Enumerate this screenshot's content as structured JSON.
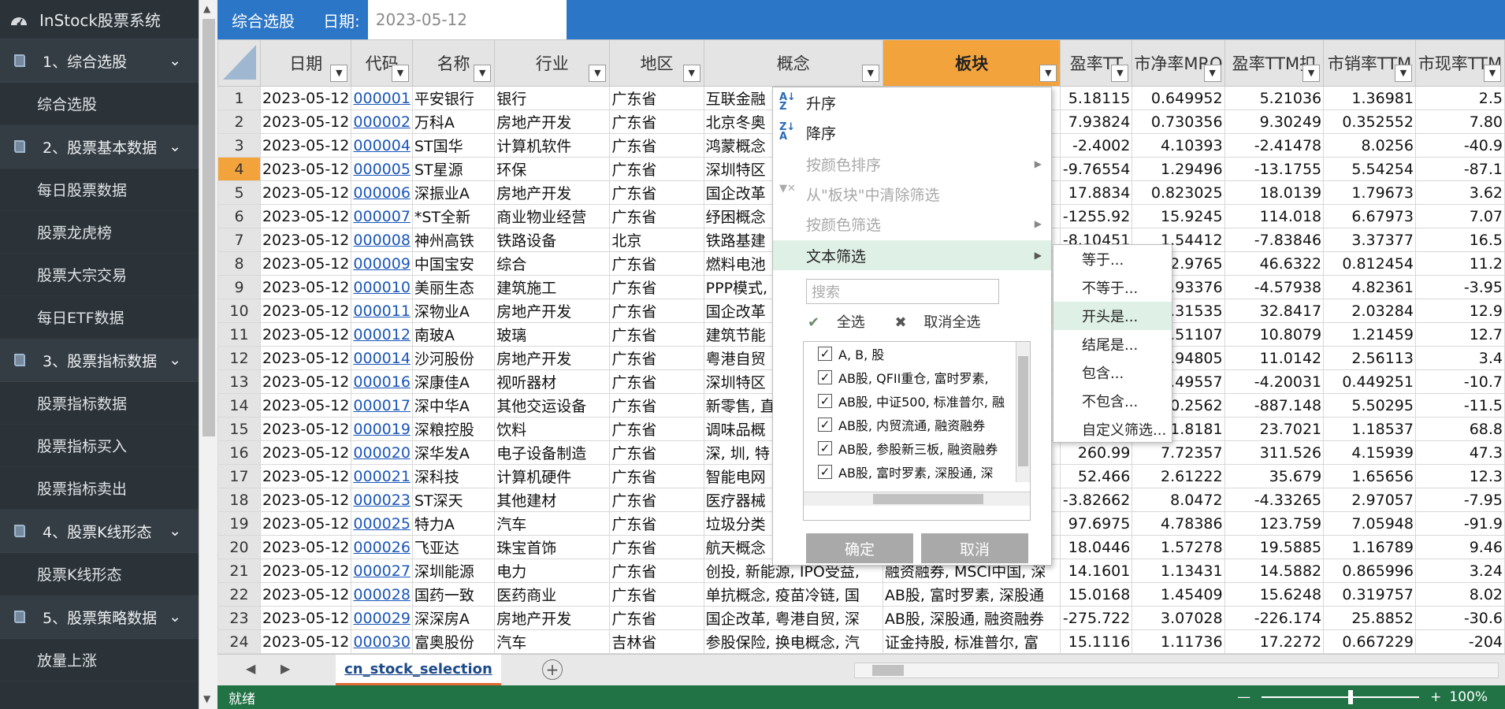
{
  "app": {
    "title": "InStock股票系统"
  },
  "sidebar": {
    "sections": [
      {
        "label": "1、综合选股",
        "items": [
          "综合选股"
        ]
      },
      {
        "label": "2、股票基本数据",
        "items": [
          "每日股票数据",
          "股票龙虎榜",
          "股票大宗交易",
          "每日ETF数据"
        ]
      },
      {
        "label": "3、股票指标数据",
        "items": [
          "股票指标数据",
          "股票指标买入",
          "股票指标卖出"
        ]
      },
      {
        "label": "4、股票K线形态",
        "items": [
          "股票K线形态"
        ]
      },
      {
        "label": "5、股票策略数据",
        "items": [
          "放量上涨"
        ]
      }
    ]
  },
  "topbar": {
    "title": "综合选股",
    "date_label": "日期:",
    "date_value": "2023-05-12"
  },
  "table": {
    "headers": [
      "日期",
      "代码",
      "名称",
      "行业",
      "地区",
      "概念",
      "板块",
      "盈率TT",
      "市净率MRQ",
      "盈率TTM扣",
      "市销率TTM",
      "市现率TTM"
    ],
    "selected_row": "4",
    "rows": [
      {
        "n": "1",
        "date": "2023-05-12",
        "code": "000001",
        "name": "平安银行",
        "industry": "银行",
        "region": "广东省",
        "concept": "互联金融",
        "board": "",
        "c1": "5.18115",
        "c2": "0.649952",
        "c3": "5.21036",
        "c4": "1.36981",
        "c5": "2.5"
      },
      {
        "n": "2",
        "date": "2023-05-12",
        "code": "000002",
        "name": "万科A",
        "industry": "房地产开发",
        "region": "广东省",
        "concept": "北京冬奥",
        "board": "",
        "c1": "7.93824",
        "c2": "0.730356",
        "c3": "9.30249",
        "c4": "0.352552",
        "c5": "7.80"
      },
      {
        "n": "3",
        "date": "2023-05-12",
        "code": "000004",
        "name": "ST国华",
        "industry": "计算机软件",
        "region": "广东省",
        "concept": "鸿蒙概念",
        "board": "",
        "c1": "-2.4002",
        "c2": "4.10393",
        "c3": "-2.41478",
        "c4": "8.0256",
        "c5": "-40.9"
      },
      {
        "n": "4",
        "date": "2023-05-12",
        "code": "000005",
        "name": "ST星源",
        "industry": "环保",
        "region": "广东省",
        "concept": "深圳特区",
        "board": "",
        "c1": "-9.76554",
        "c2": "1.29496",
        "c3": "-13.1755",
        "c4": "5.54254",
        "c5": "-87.1"
      },
      {
        "n": "5",
        "date": "2023-05-12",
        "code": "000006",
        "name": "深振业A",
        "industry": "房地产开发",
        "region": "广东省",
        "concept": "国企改革",
        "board": "",
        "c1": "17.8834",
        "c2": "0.823025",
        "c3": "18.0139",
        "c4": "1.79673",
        "c5": "3.62"
      },
      {
        "n": "6",
        "date": "2023-05-12",
        "code": "000007",
        "name": "*ST全新",
        "industry": "商业物业经营",
        "region": "广东省",
        "concept": "纾困概念",
        "board": "",
        "c1": "-1255.92",
        "c2": "15.9245",
        "c3": "114.018",
        "c4": "6.67973",
        "c5": "7.07"
      },
      {
        "n": "7",
        "date": "2023-05-12",
        "code": "000008",
        "name": "神州高铁",
        "industry": "铁路设备",
        "region": "北京",
        "concept": "铁路基建",
        "board": "",
        "c1": "-8.10451",
        "c2": "1.54412",
        "c3": "-7.83846",
        "c4": "3.37377",
        "c5": "16.5"
      },
      {
        "n": "8",
        "date": "2023-05-12",
        "code": "000009",
        "name": "中国宝安",
        "industry": "综合",
        "region": "广东省",
        "concept": "燃料电池",
        "board": "",
        "c1": "",
        "c2": "2.9765",
        "c3": "46.6322",
        "c4": "0.812454",
        "c5": "11.2"
      },
      {
        "n": "9",
        "date": "2023-05-12",
        "code": "000010",
        "name": "美丽生态",
        "industry": "建筑施工",
        "region": "广东省",
        "concept": "PPP模式,",
        "board": "",
        "c1": "",
        "c2": "3.93376",
        "c3": "-4.57938",
        "c4": "4.82361",
        "c5": "-3.95"
      },
      {
        "n": "10",
        "date": "2023-05-12",
        "code": "000011",
        "name": "深物业A",
        "industry": "房地产开发",
        "region": "广东省",
        "concept": "国企改革",
        "board": "",
        "c1": "",
        "c2": "1.31535",
        "c3": "32.8417",
        "c4": "2.03284",
        "c5": "12.9"
      },
      {
        "n": "11",
        "date": "2023-05-12",
        "code": "000012",
        "name": "南玻A",
        "industry": "玻璃",
        "region": "广东省",
        "concept": "建筑节能",
        "board": "",
        "c1": "",
        "c2": "1.51107",
        "c3": "10.8079",
        "c4": "1.21459",
        "c5": "12.7"
      },
      {
        "n": "12",
        "date": "2023-05-12",
        "code": "000014",
        "name": "沙河股份",
        "industry": "房地产开发",
        "region": "广东省",
        "concept": "粤港自贸",
        "board": "",
        "c1": "",
        "c2": "1.94805",
        "c3": "11.0142",
        "c4": "2.56113",
        "c5": "3.4"
      },
      {
        "n": "13",
        "date": "2023-05-12",
        "code": "000016",
        "name": "深康佳A",
        "industry": "视听器材",
        "region": "广东省",
        "concept": "深圳特区",
        "board": "",
        "c1": "",
        "c2": "1.49557",
        "c3": "-4.20031",
        "c4": "0.449251",
        "c5": "-10.7"
      },
      {
        "n": "14",
        "date": "2023-05-12",
        "code": "000017",
        "name": "深中华A",
        "industry": "其他交运设备",
        "region": "广东省",
        "concept": "新零售, 直",
        "board": "",
        "c1": "",
        "c2": "10.2562",
        "c3": "-887.148",
        "c4": "5.50295",
        "c5": "-11.5"
      },
      {
        "n": "15",
        "date": "2023-05-12",
        "code": "000019",
        "name": "深粮控股",
        "industry": "饮料",
        "region": "广东省",
        "concept": "调味品概",
        "board": "",
        "c1": "",
        "c2": "1.8181",
        "c3": "23.7021",
        "c4": "1.18537",
        "c5": "68.8"
      },
      {
        "n": "16",
        "date": "2023-05-12",
        "code": "000020",
        "name": "深华发A",
        "industry": "电子设备制造",
        "region": "广东省",
        "concept": "深, 圳, 特",
        "board": "",
        "c1": "260.99",
        "c2": "7.72357",
        "c3": "311.526",
        "c4": "4.15939",
        "c5": "47.3"
      },
      {
        "n": "17",
        "date": "2023-05-12",
        "code": "000021",
        "name": "深科技",
        "industry": "计算机硬件",
        "region": "广东省",
        "concept": "智能电网",
        "board": "",
        "c1": "52.466",
        "c2": "2.61222",
        "c3": "35.679",
        "c4": "1.65656",
        "c5": "12.3"
      },
      {
        "n": "18",
        "date": "2023-05-12",
        "code": "000023",
        "name": "ST深天",
        "industry": "其他建材",
        "region": "广东省",
        "concept": "医疗器械",
        "board": "",
        "c1": "-3.82662",
        "c2": "8.0472",
        "c3": "-4.33265",
        "c4": "2.97057",
        "c5": "-7.95"
      },
      {
        "n": "19",
        "date": "2023-05-12",
        "code": "000025",
        "name": "特力A",
        "industry": "汽车",
        "region": "广东省",
        "concept": "垃圾分类",
        "board": "",
        "c1": "97.6975",
        "c2": "4.78386",
        "c3": "123.759",
        "c4": "7.05948",
        "c5": "-91.9"
      },
      {
        "n": "20",
        "date": "2023-05-12",
        "code": "000026",
        "name": "飞亚达",
        "industry": "珠宝首饰",
        "region": "广东省",
        "concept": "航天概念",
        "board": "",
        "c1": "18.0446",
        "c2": "1.57278",
        "c3": "19.5885",
        "c4": "1.16789",
        "c5": "9.46"
      },
      {
        "n": "21",
        "date": "2023-05-12",
        "code": "000027",
        "name": "深圳能源",
        "industry": "电力",
        "region": "广东省",
        "concept": "创投, 新能源, IPO受益,",
        "board": "融资融券, MSCI中国, 深",
        "c1": "14.1601",
        "c2": "1.13431",
        "c3": "14.5882",
        "c4": "0.865996",
        "c5": "3.24"
      },
      {
        "n": "22",
        "date": "2023-05-12",
        "code": "000028",
        "name": "国药一致",
        "industry": "医药商业",
        "region": "广东省",
        "concept": "单抗概念, 疫苗冷链, 国",
        "board": "AB股, 富时罗素, 深股通",
        "c1": "15.0168",
        "c2": "1.45409",
        "c3": "15.6248",
        "c4": "0.319757",
        "c5": "8.02"
      },
      {
        "n": "23",
        "date": "2023-05-12",
        "code": "000029",
        "name": "深深房A",
        "industry": "房地产开发",
        "region": "广东省",
        "concept": "国企改革, 粤港自贸, 深",
        "board": "AB股, 深股通, 融资融券",
        "c1": "-275.722",
        "c2": "3.07028",
        "c3": "-226.174",
        "c4": "25.8852",
        "c5": "-30.6"
      },
      {
        "n": "24",
        "date": "2023-05-12",
        "code": "000030",
        "name": "富奥股份",
        "industry": "汽车",
        "region": "吉林省",
        "concept": "参股保险, 换电概念, 汽",
        "board": "证金持股, 标准普尔, 富",
        "c1": "15.1116",
        "c2": "1.11736",
        "c3": "17.2272",
        "c4": "0.667229",
        "c5": "-204"
      }
    ]
  },
  "filter_menu": {
    "sort_asc": "升序",
    "sort_desc": "降序",
    "sort_by_color": "按颜色排序",
    "clear_filter": "从\"板块\"中清除筛选",
    "filter_by_color": "按颜色筛选",
    "text_filter": "文本筛选",
    "search_placeholder": "搜索",
    "select_all": "全选",
    "deselect_all": "取消全选",
    "list_items": [
      "A, B, 股",
      "AB股, QFII重仓, 富时罗素, ",
      "AB股, 中证500, 标准普尔, 融",
      "AB股, 内贸流通, 融资融券",
      "AB股, 参股新三板, 融资融券",
      "AB股, 富时罗素, 深股通, 深"
    ],
    "ok": "确定",
    "cancel": "取消"
  },
  "text_filter_submenu": [
    "等于...",
    "不等于...",
    "开头是...",
    "结尾是...",
    "包含...",
    "不包含...",
    "自定义筛选..."
  ],
  "sheet_tab": "cn_stock_selection",
  "status": {
    "ready": "就绪",
    "zoom": "100%"
  },
  "colors": {
    "header_highlight": "#f3a33c",
    "topbar": "#2b76c7",
    "sidebar": "#2b3238",
    "statusbar": "#217346"
  }
}
